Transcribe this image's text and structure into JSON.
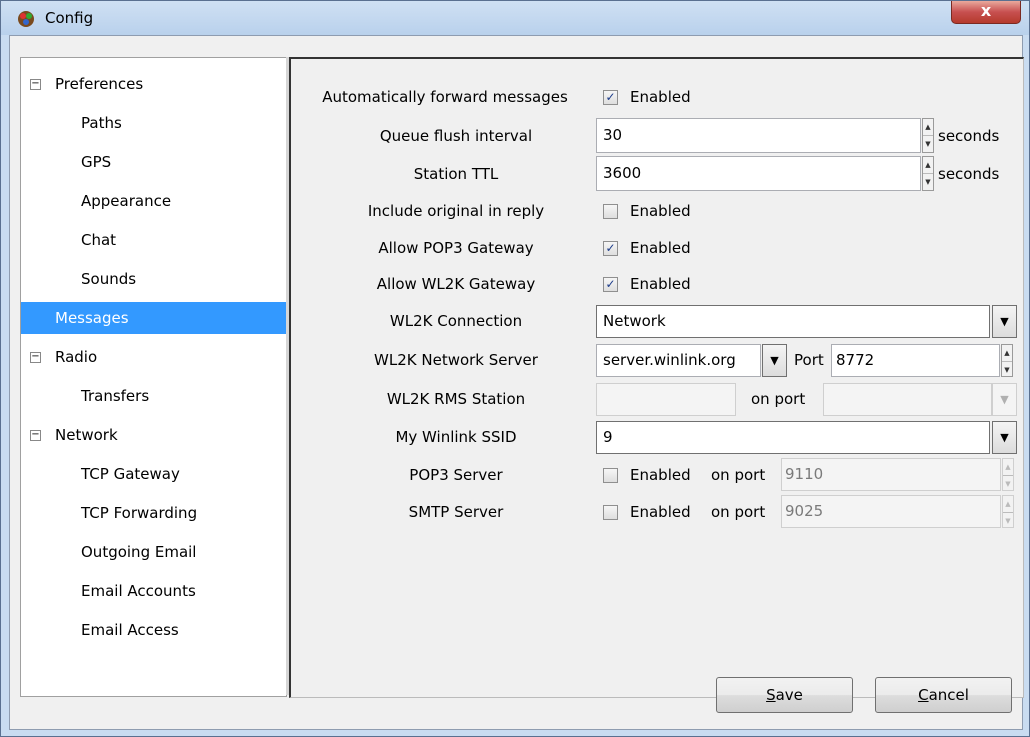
{
  "window": {
    "title": "Config",
    "close_label": "x"
  },
  "tree": {
    "items": [
      {
        "label": "Preferences",
        "level": 0,
        "expander": "−"
      },
      {
        "label": "Paths",
        "level": 1
      },
      {
        "label": "GPS",
        "level": 1
      },
      {
        "label": "Appearance",
        "level": 1
      },
      {
        "label": "Chat",
        "level": 1
      },
      {
        "label": "Sounds",
        "level": 1
      },
      {
        "label": "Messages",
        "level": 0,
        "selected": true
      },
      {
        "label": "Radio",
        "level": 0,
        "expander": "−"
      },
      {
        "label": "Transfers",
        "level": 1
      },
      {
        "label": "Network",
        "level": 0,
        "expander": "−"
      },
      {
        "label": "TCP Gateway",
        "level": 1
      },
      {
        "label": "TCP Forwarding",
        "level": 1
      },
      {
        "label": "Outgoing Email",
        "level": 1
      },
      {
        "label": "Email Accounts",
        "level": 1
      },
      {
        "label": "Email Access",
        "level": 1
      }
    ]
  },
  "messages": {
    "auto_forward": {
      "label": "Automatically forward messages",
      "checkbox_text": "Enabled",
      "checked": true
    },
    "queue_flush": {
      "label": "Queue flush interval",
      "value": "30",
      "unit": "seconds"
    },
    "station_ttl": {
      "label": "Station TTL",
      "value": "3600",
      "unit": "seconds"
    },
    "include_original": {
      "label": "Include original in reply",
      "checkbox_text": "Enabled",
      "checked": false
    },
    "pop3_gateway": {
      "label": "Allow POP3 Gateway",
      "checkbox_text": "Enabled",
      "checked": true
    },
    "wl2k_gateway": {
      "label": "Allow WL2K Gateway",
      "checkbox_text": "Enabled",
      "checked": true
    },
    "wl2k_connection": {
      "label": "WL2K Connection",
      "value": "Network"
    },
    "wl2k_server": {
      "label": "WL2K Network Server",
      "value": "server.winlink.org",
      "port_label": "Port",
      "port_value": "8772"
    },
    "wl2k_rms": {
      "label": "WL2K RMS Station",
      "value": "",
      "port_label": "on port",
      "port_value": ""
    },
    "ssid": {
      "label": "My Winlink SSID",
      "value": "9"
    },
    "pop3_server": {
      "label": "POP3 Server",
      "checkbox_text": "Enabled",
      "port_label": "on port",
      "port_value": "9110",
      "checked": false
    },
    "smtp_server": {
      "label": "SMTP Server",
      "checkbox_text": "Enabled",
      "port_label": "on port",
      "port_value": "9025",
      "checked": false
    }
  },
  "buttons": {
    "save": {
      "mnemonic": "S",
      "rest": "ave"
    },
    "cancel": {
      "mnemonic": "C",
      "rest": "ancel"
    }
  },
  "colors": {
    "selection": "#3399ff",
    "titlebar": "#c9dcf1",
    "close_button": "#c75050"
  }
}
